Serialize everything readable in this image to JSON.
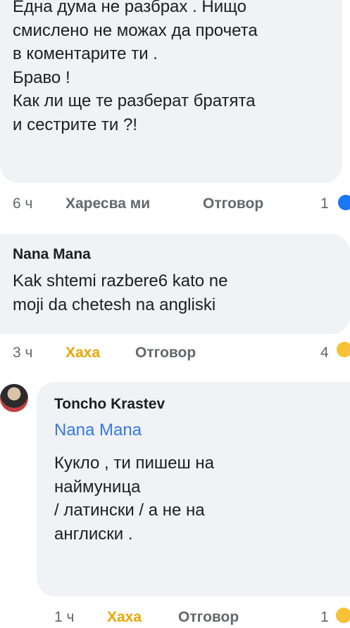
{
  "comment1": {
    "text": "Една дума не разбрах . Нищо\nсмислено не можах да прочета\nв коментарите ти .\nБраво !\nКак ли ще те разберат братята\nи сестрите ти ?!",
    "time": "6 ч",
    "like_label": "Харесва ми",
    "reply_label": "Отговор",
    "reaction_count": "1",
    "reaction_icon": "like-icon"
  },
  "comment2": {
    "author": "Nana Mana",
    "text": "Kak shtemi razbere6 kato ne\nmoji da chetesh na angliski",
    "time": "3 ч",
    "reaction_label": "Хаха",
    "reply_label": "Отговор",
    "reaction_count": "4",
    "reaction_icon": "haha-icon"
  },
  "comment3": {
    "author": "Toncho Krastev",
    "mention": "Nana Mana",
    "text": "Кукло , ти пишеш на\nнаймуница\n/ латински / а не на\nанглиски .",
    "time": "1 ч",
    "reaction_label": "Хаха",
    "reply_label": "Отговор",
    "reaction_count": "1",
    "reaction_icon": "haha-icon"
  },
  "colors": {
    "bubble": "#f0f2f5",
    "meta": "#65676b",
    "haha": "#e6a700",
    "mention": "#3578e5",
    "like": "#1877f2"
  }
}
